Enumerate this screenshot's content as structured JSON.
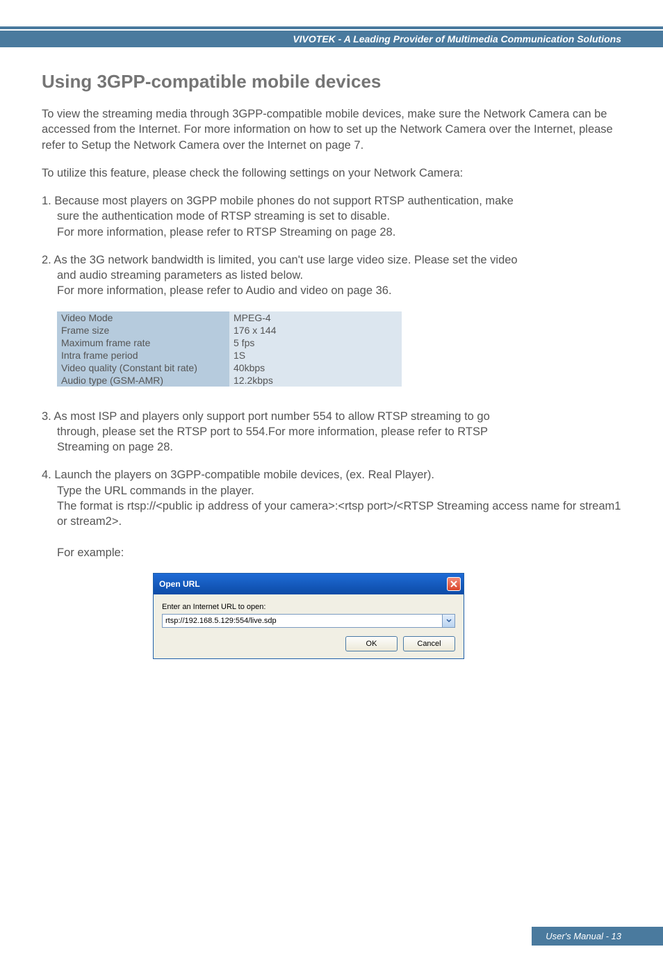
{
  "header": {
    "brand": "VIVOTEK - A Leading Provider of Multimedia Communication Solutions"
  },
  "title": "Using 3GPP-compatible mobile devices",
  "p1": "To view the streaming media through 3GPP-compatible mobile devices, make sure the Network Camera can be accessed from the Internet. For more information on how to set up the Network Camera over the Internet, please refer to Setup the Network Camera over the Internet on page 7.",
  "p2": "To utilize this feature, please check the following settings on your Network Camera:",
  "item1": {
    "l1": "1. Because most players on 3GPP mobile phones do not support RTSP authentication, make",
    "l2": "sure the authentication mode of RTSP streaming is set to disable.",
    "l3": "For more information, please refer to RTSP Streaming on page 28."
  },
  "item2": {
    "l1": "2. As the 3G network bandwidth is limited, you can't use large video size. Please set the video",
    "l2": "and audio streaming parameters as listed below.",
    "l3": "For more information, please refer to Audio and video on page 36."
  },
  "table": {
    "rows": [
      {
        "label": "Video Mode",
        "value": "MPEG-4"
      },
      {
        "label": "Frame size",
        "value": "176 x 144"
      },
      {
        "label": "Maximum frame rate",
        "value": "5 fps"
      },
      {
        "label": "Intra frame period",
        "value": "1S"
      },
      {
        "label": "Video quality (Constant bit rate)",
        "value": "40kbps"
      },
      {
        "label": "Audio type (GSM-AMR)",
        "value": "12.2kbps"
      }
    ]
  },
  "item3": {
    "l1": "3. As most ISP and players only support port number 554 to allow RTSP streaming to go",
    "l2": "through, please set the RTSP port to 554.For more information, please refer to RTSP",
    "l3": "Streaming on page 28."
  },
  "item4": {
    "l1": "4. Launch the players on 3GPP-compatible mobile devices, (ex. Real Player).",
    "l2": "Type the URL commands in the player.",
    "l3": "The format is rtsp://<public ip address of your camera>:<rtsp port>/<RTSP Streaming access name for stream1 or stream2>.",
    "l4": "For example:"
  },
  "dialog": {
    "title": "Open URL",
    "label": "Enter an Internet URL to open:",
    "url": "rtsp://192.168.5.129:554/live.sdp",
    "ok": "OK",
    "cancel": "Cancel"
  },
  "footer": "User's Manual - 13"
}
